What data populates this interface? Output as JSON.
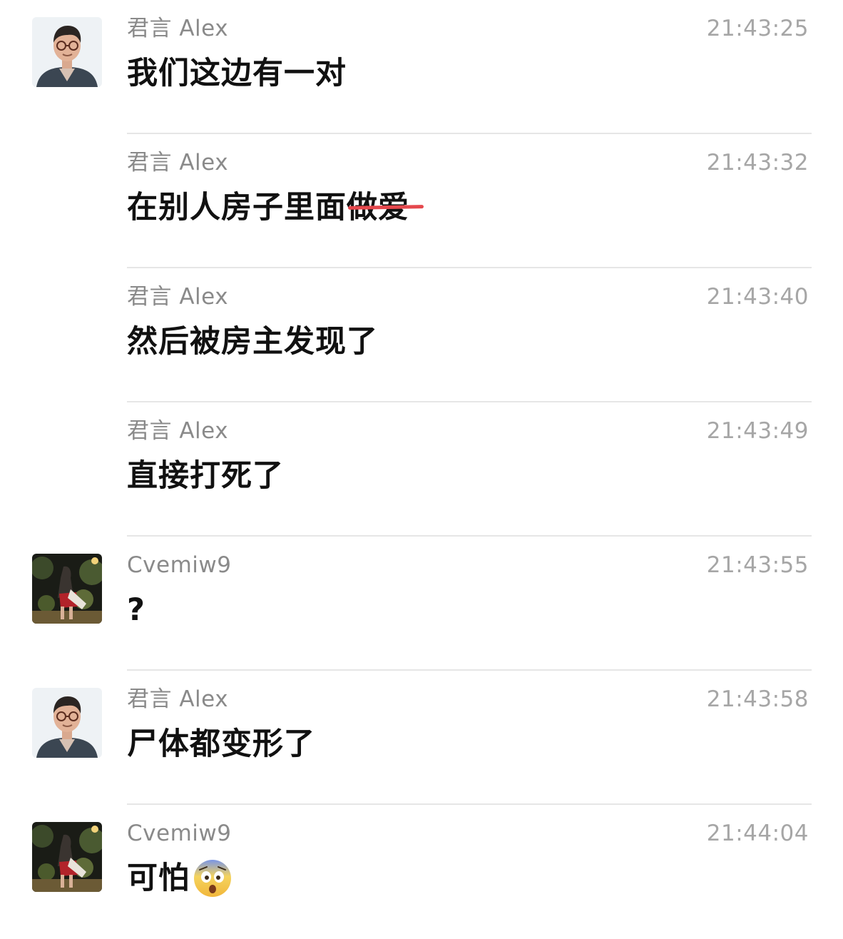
{
  "messages": [
    {
      "sender": "君言 Alex",
      "time": "21:43:25",
      "text": "我们这边有一对",
      "avatar": "alex-avatar"
    },
    {
      "sender": "君言 Alex",
      "time": "21:43:32",
      "text": "在别人房子里面",
      "strike_text": "做爱"
    },
    {
      "sender": "君言 Alex",
      "time": "21:43:40",
      "text": "然后被房主发现了"
    },
    {
      "sender": "君言 Alex",
      "time": "21:43:49",
      "text": "直接打死了"
    },
    {
      "sender": "Cvemiw9",
      "time": "21:43:55",
      "text": "?",
      "avatar": "cvemiw9-avatar"
    },
    {
      "sender": "君言 Alex",
      "time": "21:43:58",
      "text": "尸体都变形了",
      "avatar": "alex-avatar"
    },
    {
      "sender": "Cvemiw9",
      "time": "21:44:04",
      "text": "可怕",
      "avatar": "cvemiw9-avatar",
      "emoji": "fearful-face-emoji"
    }
  ],
  "colors": {
    "sender": "#8a8a8a",
    "time": "#a6a6a6",
    "text": "#111111",
    "divider": "#e6e6e6",
    "strike": "#e5484d"
  }
}
